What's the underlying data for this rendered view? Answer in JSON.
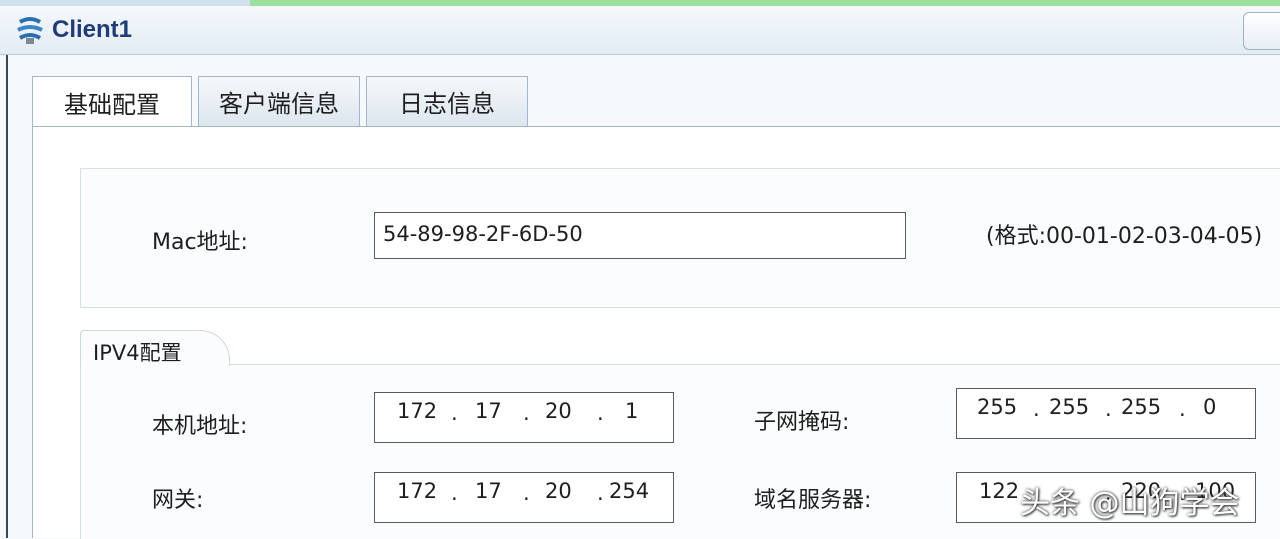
{
  "window": {
    "title": "Client1"
  },
  "tabs": [
    {
      "label": "基础配置",
      "active": true
    },
    {
      "label": "客户端信息",
      "active": false
    },
    {
      "label": "日志信息",
      "active": false
    }
  ],
  "mac": {
    "label": "Mac地址:",
    "value": "54-89-98-2F-6D-50",
    "hint": "(格式:00-01-02-03-04-05)"
  },
  "ipv4": {
    "section_label": "IPV4配置",
    "local_ip": {
      "label": "本机地址:",
      "octets": [
        "172",
        "17",
        "20",
        "1"
      ]
    },
    "subnet_mask": {
      "label": "子网掩码:",
      "octets": [
        "255",
        "255",
        "255",
        "0"
      ]
    },
    "gateway": {
      "label": "网关:",
      "octets": [
        "172",
        "17",
        "20",
        "254"
      ]
    },
    "dns": {
      "label": "域名服务器:",
      "octets": [
        "122",
        "",
        "220",
        "100"
      ]
    }
  },
  "watermark": "头条 @山狗学会",
  "colors": {
    "title": "#1f3c7a",
    "tab_border": "#a7b6c6",
    "field_border": "#5b5b5b"
  }
}
